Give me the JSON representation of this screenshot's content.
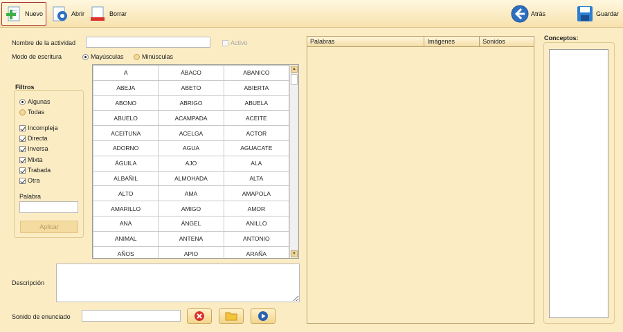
{
  "toolbar": {
    "nuevo": "Nuevo",
    "abrir": "Abrir",
    "borrar": "Borrar",
    "atras": "Atrás",
    "guardar": "Guardar"
  },
  "form": {
    "activity_name_label": "Nombre de la actividad",
    "activity_name_value": "",
    "active_label": "Activo",
    "active_checked": false,
    "writing_mode_label": "Modo de escritura",
    "writing_mode_upper": "Mayúsculas",
    "writing_mode_lower": "Minúsculas",
    "writing_mode_selected": "Mayúsculas",
    "description_label": "Descripción",
    "description_value": "",
    "sound_label": "Sonido de enunciado",
    "sound_value": ""
  },
  "filters": {
    "title": "Filtros",
    "scope_some": "Algunas",
    "scope_all": "Todas",
    "scope_selected": "Algunas",
    "types": [
      {
        "label": "Incompleja",
        "checked": true
      },
      {
        "label": "Directa",
        "checked": true
      },
      {
        "label": "Inversa",
        "checked": true
      },
      {
        "label": "Mixta",
        "checked": true
      },
      {
        "label": "Trabada",
        "checked": true
      },
      {
        "label": "Otra",
        "checked": true
      }
    ],
    "word_label": "Palabra",
    "word_value": "",
    "apply_label": "Aplicar"
  },
  "word_grid": [
    [
      "A",
      "ÁBACO",
      "ABANICO"
    ],
    [
      "ABEJA",
      "ABETO",
      "ABIERTA"
    ],
    [
      "ABONO",
      "ABRIGO",
      "ABUELA"
    ],
    [
      "ABUELO",
      "ACAMPADA",
      "ACEITE"
    ],
    [
      "ACEITUNA",
      "ACELGA",
      "ACTOR"
    ],
    [
      "ADORNO",
      "AGUA",
      "AGUACATE"
    ],
    [
      "ÁGUILA",
      "AJO",
      "ALA"
    ],
    [
      "ALBAÑIL",
      "ALMOHADA",
      "ALTA"
    ],
    [
      "ALTO",
      "AMA",
      "AMAPOLA"
    ],
    [
      "AMARILLO",
      "AMIGO",
      "AMOR"
    ],
    [
      "ANA",
      "ÁNGEL",
      "ANILLO"
    ],
    [
      "ANIMAL",
      "ANTENA",
      "ANTONIO"
    ],
    [
      "AÑOS",
      "APIO",
      "ARAÑA"
    ]
  ],
  "words_table": {
    "columns": [
      "Palabras",
      "Imágenes",
      "Sonidos"
    ]
  },
  "concepts": {
    "title": "Conceptos:"
  }
}
